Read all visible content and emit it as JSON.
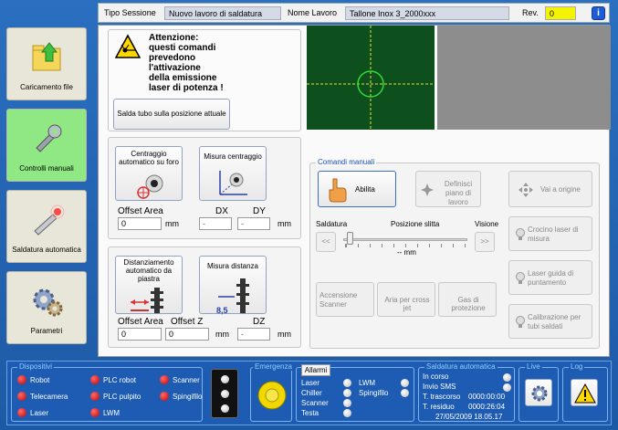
{
  "header": {
    "tipo_label": "Tipo Sessione",
    "tipo_value": "Nuovo lavoro di saldatura",
    "nome_label": "Nome Lavoro",
    "nome_value": "Tallone Inox 3_2000xxx",
    "rev_label": "Rev.",
    "rev_value": "0",
    "info": "i"
  },
  "nav": {
    "caricamento": "Caricamento file",
    "controlli": "Controlli manuali",
    "saldatura": "Saldatura automatica",
    "parametri": "Parametri"
  },
  "warning": {
    "text1": "Attenzione:",
    "text2": "questi comandi",
    "text3": "prevedono",
    "text4": "l'attivazione",
    "text5": "della emissione",
    "text6": "laser di potenza !",
    "button": "Salda tubo sulla posizione attuale"
  },
  "center": {
    "btn_auto": "Centraggio automatico su foro",
    "btn_misura": "Misura centraggio",
    "offset_area_label": "Offset Area",
    "offset_area_val": "0",
    "unit_mm": "mm",
    "dx_label": "DX",
    "dy_label": "DY",
    "dx_val": "-",
    "dy_val": "-"
  },
  "distance": {
    "btn_auto": "Distanziamento automatico da piastra",
    "btn_misura": "Misura distanza",
    "offset_area_label": "Offset Area",
    "offset_z_label": "Offset Z",
    "offset_area_val": "0",
    "offset_z_val": "0",
    "dz_label": "DZ",
    "dz_val": "-",
    "unit_mm": "mm",
    "misura_val": "8,5"
  },
  "manual": {
    "title": "Comandi manuali",
    "abilita": "Abilita",
    "definisci": "Definisci piano di lavoro",
    "vai_origine": "Vai a origine",
    "saldatura": "Saldatura",
    "posizione": "Posizione slitta",
    "visione": "Visione",
    "slider_val": "-- mm",
    "prev": "<<",
    "next": ">>",
    "crocino": "Crocino laser di misura",
    "guida": "Laser guida di puntamento",
    "accensione": "Accensione Scanner",
    "aria": "Aria per cross jet",
    "gas": "Gas di protezione",
    "calibrazione": "Calibrazione per tubi saldati"
  },
  "bottom": {
    "dispositivi": "Dispositivi",
    "dev": [
      "Robot",
      "PLC robot",
      "Scanner",
      "Telecamera",
      "PLC pulpito",
      "Spingifilo",
      "Laser",
      "LWM"
    ],
    "emergenza": "Emergenza",
    "allarmi": "Allarmi",
    "alarms_left": [
      "Laser",
      "Chiller",
      "Scanner",
      "Testa"
    ],
    "alarms_right": [
      "LWM",
      "Spingifilo"
    ],
    "saldatura_auto": "Saldatura automatica",
    "in_corso": "In corso",
    "invio_sms": "Invio SMS",
    "t_trascorso_label": "T. trascorso",
    "t_trascorso": "0000:00:00",
    "t_residuo_label": "T. residuo",
    "t_residuo": "0000:26:04",
    "datetime": "27/05/2009 18.05.17",
    "live": "Live",
    "log": "Log"
  },
  "colors": {
    "background": "#1f5fa8",
    "active_nav": "#8fe883",
    "rev_highlight": "#f4f400",
    "camera": "#0e4f1e",
    "alarm_led": "#c40000"
  }
}
